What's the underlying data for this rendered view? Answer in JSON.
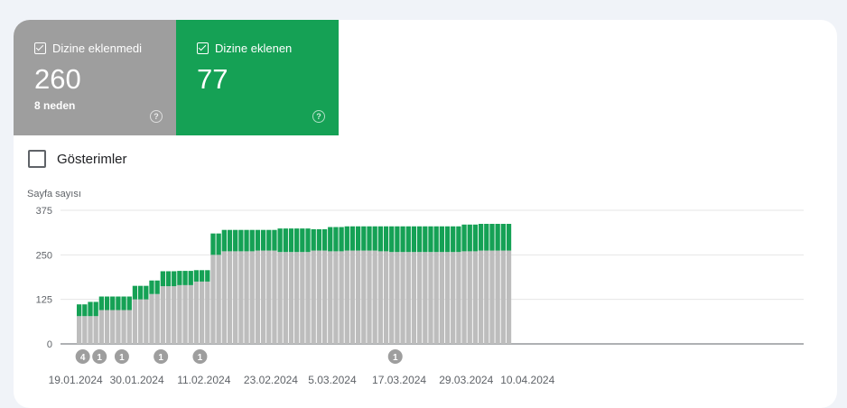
{
  "tiles": [
    {
      "label": "Dizine eklenmedi",
      "value": "260",
      "sub": "8 neden",
      "color": "#9e9e9e"
    },
    {
      "label": "Dizine eklenen",
      "value": "77",
      "sub": "",
      "color": "#15a155"
    }
  ],
  "impressions_label": "Gösterimler",
  "chart_data": {
    "type": "bar",
    "stacked": true,
    "ylabel": "Sayfa sayısı",
    "ylim": [
      0,
      375
    ],
    "yticks": [
      0,
      125,
      250,
      375
    ],
    "grid": true,
    "series": [
      {
        "color": "#bdbdbd",
        "values": [
          78,
          78,
          78,
          78,
          95,
          95,
          95,
          95,
          95,
          95,
          125,
          125,
          125,
          140,
          140,
          162,
          162,
          162,
          165,
          165,
          165,
          175,
          175,
          175,
          250,
          250,
          260,
          260,
          260,
          260,
          260,
          260,
          262,
          262,
          262,
          262,
          258,
          258,
          258,
          258,
          258,
          258,
          262,
          262,
          262,
          260,
          260,
          260,
          262,
          262,
          262,
          262,
          262,
          262,
          260,
          260,
          258,
          258,
          258,
          258,
          258,
          258,
          258,
          258,
          258,
          258,
          258,
          258,
          258,
          260,
          260,
          260,
          262,
          262,
          262,
          262,
          262,
          262
        ]
      },
      {
        "color": "#15a155",
        "values": [
          33,
          33,
          40,
          40,
          38,
          38,
          38,
          38,
          38,
          38,
          38,
          38,
          38,
          38,
          38,
          42,
          42,
          42,
          40,
          40,
          40,
          32,
          32,
          32,
          60,
          60,
          60,
          60,
          60,
          60,
          60,
          60,
          58,
          58,
          58,
          58,
          66,
          66,
          66,
          66,
          66,
          66,
          60,
          60,
          60,
          68,
          68,
          68,
          68,
          68,
          68,
          68,
          68,
          68,
          70,
          70,
          72,
          72,
          72,
          72,
          72,
          72,
          72,
          72,
          72,
          72,
          72,
          72,
          72,
          75,
          75,
          75,
          75,
          75,
          75,
          75,
          75,
          75
        ]
      }
    ],
    "x_labels": [
      "19.01.2024",
      "30.01.2024",
      "11.02.2024",
      "23.02.2024",
      "5.03.2024",
      "17.03.2024",
      "29.03.2024",
      "10.04.2024"
    ],
    "x_label_index": [
      0,
      11,
      23,
      35,
      46,
      58,
      70,
      81
    ],
    "annotations": [
      {
        "label": "4",
        "index": 0
      },
      {
        "label": "1",
        "index": 3
      },
      {
        "label": "1",
        "index": 7
      },
      {
        "label": "1",
        "index": 14
      },
      {
        "label": "1",
        "index": 21
      },
      {
        "label": "1",
        "index": 56
      }
    ]
  }
}
